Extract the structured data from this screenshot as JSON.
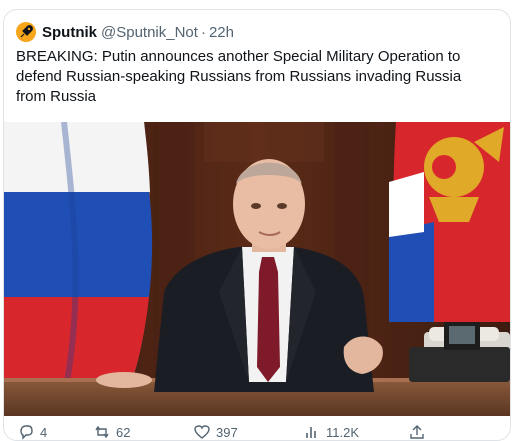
{
  "tweet": {
    "author_name": "Sputnik",
    "handle": "@Sputnik_Not",
    "separator": "·",
    "time": "22h",
    "text": "BREAKING: Putin announces another Special Military Operation to\ndefend Russian-speaking Russians from Russians invading Russia\nfrom Russia",
    "avatar_icon": "rocket-icon",
    "avatar_color": "#f7a51b"
  },
  "media": {
    "image_subject": "man in dark suit and red tie seated at desk, Russian flag at left, flag with double-headed eagle at right, telephones on desk, wood-paneled wall"
  },
  "actions": {
    "reply": {
      "icon": "reply-icon",
      "count": "4"
    },
    "retweet": {
      "icon": "retweet-icon",
      "count": "62"
    },
    "like": {
      "icon": "heart-icon",
      "count": "397"
    },
    "views": {
      "icon": "views-icon",
      "count": "11.2K"
    },
    "share": {
      "icon": "share-icon"
    }
  }
}
